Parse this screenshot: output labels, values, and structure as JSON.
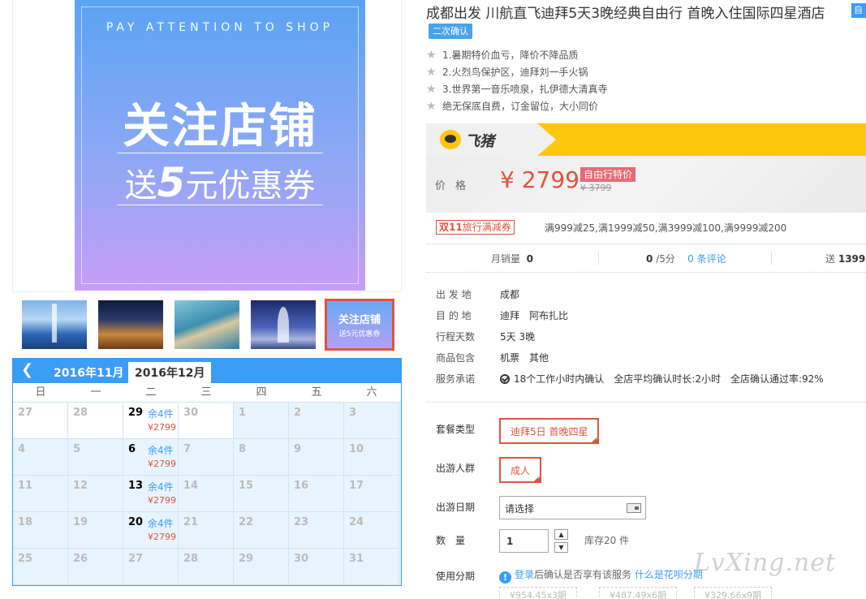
{
  "product": {
    "title": "成都出发 川航直飞迪拜5天3晚经典自由行 首晚入住国际四星酒店",
    "title_tag": "自",
    "confirm_badge": "二次确认",
    "features": [
      "1.暑期特价血亏，降价不降品质",
      "2.火烈鸟保护区，迪拜刘一手火锅",
      "3.世界第一音乐喷泉，扎伊德大清真寺",
      "绝无保底自费，订金留位，大小同价"
    ]
  },
  "main_image": {
    "top_text": "PAY ATTENTION TO SHOP",
    "headline": "关注店铺",
    "coupon_prefix": "送",
    "coupon_amount": "5",
    "coupon_suffix": "元优惠券"
  },
  "thumbnails": {
    "selected_line1": "关注店铺",
    "selected_line2": "送5元优惠券"
  },
  "calendar": {
    "tabs": [
      "2016年11月",
      "2016年12月"
    ],
    "weekdays": [
      "日",
      "一",
      "二",
      "三",
      "四",
      "五",
      "六"
    ],
    "weeks": [
      [
        {
          "d": "27"
        },
        {
          "d": "28"
        },
        {
          "d": "29",
          "stock": "余4件",
          "price": "¥2799"
        },
        {
          "d": "30"
        },
        {
          "d": "1"
        },
        {
          "d": "2"
        },
        {
          "d": "3"
        }
      ],
      [
        {
          "d": "4"
        },
        {
          "d": "5"
        },
        {
          "d": "6",
          "stock": "余4件",
          "price": "¥2799"
        },
        {
          "d": "7"
        },
        {
          "d": "8"
        },
        {
          "d": "9"
        },
        {
          "d": "10"
        }
      ],
      [
        {
          "d": "11"
        },
        {
          "d": "12"
        },
        {
          "d": "13",
          "stock": "余4件",
          "price": "¥2799"
        },
        {
          "d": "14"
        },
        {
          "d": "15"
        },
        {
          "d": "16"
        },
        {
          "d": "17"
        }
      ],
      [
        {
          "d": "18"
        },
        {
          "d": "19"
        },
        {
          "d": "20",
          "stock": "余4件",
          "price": "¥2799"
        },
        {
          "d": "21"
        },
        {
          "d": "22"
        },
        {
          "d": "23"
        },
        {
          "d": "24"
        }
      ],
      [
        {
          "d": "25"
        },
        {
          "d": "26"
        },
        {
          "d": "27"
        },
        {
          "d": "28"
        },
        {
          "d": "29"
        },
        {
          "d": "30"
        },
        {
          "d": "31"
        }
      ]
    ]
  },
  "brand": {
    "logo_text": "飞猪",
    "brand_yellow": "#ffc60c"
  },
  "price": {
    "label": "价格",
    "value": "¥ 2799",
    "tag": "自由行特价",
    "original": "¥ 3799",
    "accent_color": "#e0533e"
  },
  "promo": {
    "badge_prefix": "双11",
    "badge_text": "旅行满减券",
    "text": "满999减25,满1999减50,满3999减100,满9999减200"
  },
  "stats": {
    "monthly_label": "月销量",
    "monthly_value": "0",
    "rating_value": "0",
    "rating_suffix": "/5分",
    "reviews_count": "0",
    "reviews_label": "条评论",
    "points_prefix": "送",
    "points_value": "1399"
  },
  "info": {
    "rows": [
      {
        "k": "出 发 地",
        "v": [
          "成都"
        ]
      },
      {
        "k": "目 的 地",
        "v": [
          "迪拜",
          "阿布扎比"
        ]
      },
      {
        "k": "行程天数",
        "v": [
          "5天 3晚"
        ]
      },
      {
        "k": "商品包含",
        "v": [
          "机票",
          "其他"
        ]
      }
    ],
    "service_label": "服务承诺",
    "service_items": [
      "18个工作小时内确认",
      "全店平均确认时长:2小时",
      "全店确认通过率:92%"
    ]
  },
  "options": {
    "package_label": "套餐类型",
    "package_value": "迪拜5日 首晚四星",
    "people_label": "出游人群",
    "people_value": "成人",
    "date_label": "出游日期",
    "date_placeholder": "请选择",
    "qty_label": "数　量",
    "qty_value": "1",
    "stock_text": "库存20 件",
    "install_label": "使用分期",
    "install_login": "登录",
    "install_mid": "后确认是否享有该服务",
    "install_link": "什么是花呗分期",
    "install_options": [
      "¥954.45x3期",
      "¥487.49x6期",
      "¥329.66x9期"
    ]
  },
  "watermark": "LvXing.net"
}
